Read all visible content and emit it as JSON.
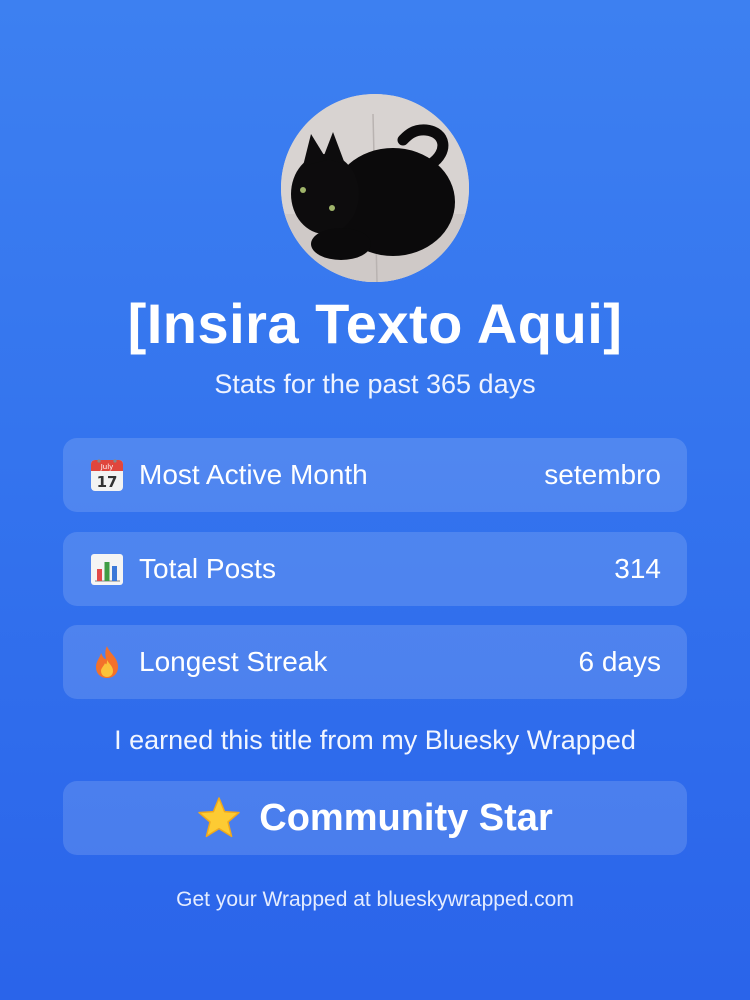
{
  "profile": {
    "name": "[Insira Texto Aqui]",
    "subtitle": "Stats for the past 365 days"
  },
  "stats": [
    {
      "icon": "calendar-icon",
      "label": "Most Active Month",
      "value": "setembro"
    },
    {
      "icon": "bar-chart-icon",
      "label": "Total Posts",
      "value": "314"
    },
    {
      "icon": "fire-icon",
      "label": "Longest Streak",
      "value": "6 days"
    }
  ],
  "calendar_icon": {
    "month": "July",
    "day": "17"
  },
  "earned_text": "I earned this title from my Bluesky Wrapped",
  "title_badge": {
    "icon": "star-icon",
    "label": "Community Star"
  },
  "footer": "Get your Wrapped at blueskywrapped.com",
  "colors": {
    "background_top": "#3d80f1",
    "background_bottom": "#2a64ea",
    "card": "rgba(255,255,255,0.14)"
  }
}
